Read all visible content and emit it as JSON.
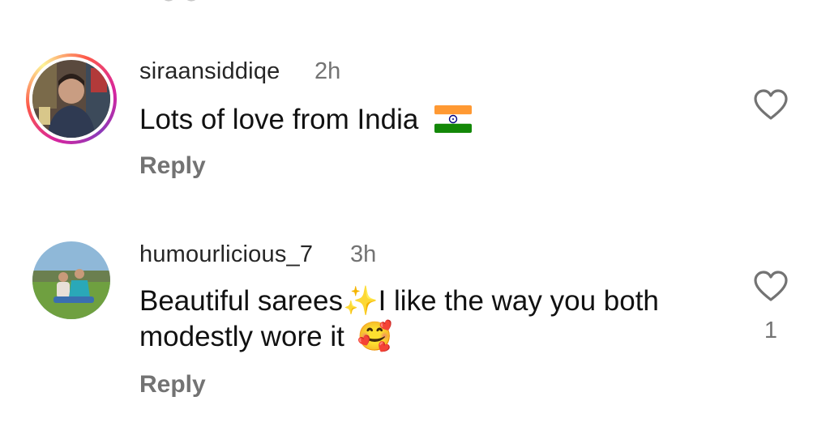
{
  "comments": [
    {
      "username": "siraansiddiqe",
      "time": "2h",
      "text": "Lots of love from India",
      "emoji": "flag-india",
      "reply_label": "Reply",
      "like_count": ""
    },
    {
      "username": "humourlicious_7",
      "time": "3h",
      "text_part1": "Beautiful sarees",
      "text_part2": "I like the way you both",
      "text_line2": "modestly wore it",
      "emoji_sparkles": "✨",
      "emoji_smile": "🥰",
      "reply_label": "Reply",
      "like_count": "1"
    }
  ],
  "colors": {
    "secondary_text": "#737373",
    "primary_text": "#111111",
    "story_ring": "#d6249f"
  }
}
